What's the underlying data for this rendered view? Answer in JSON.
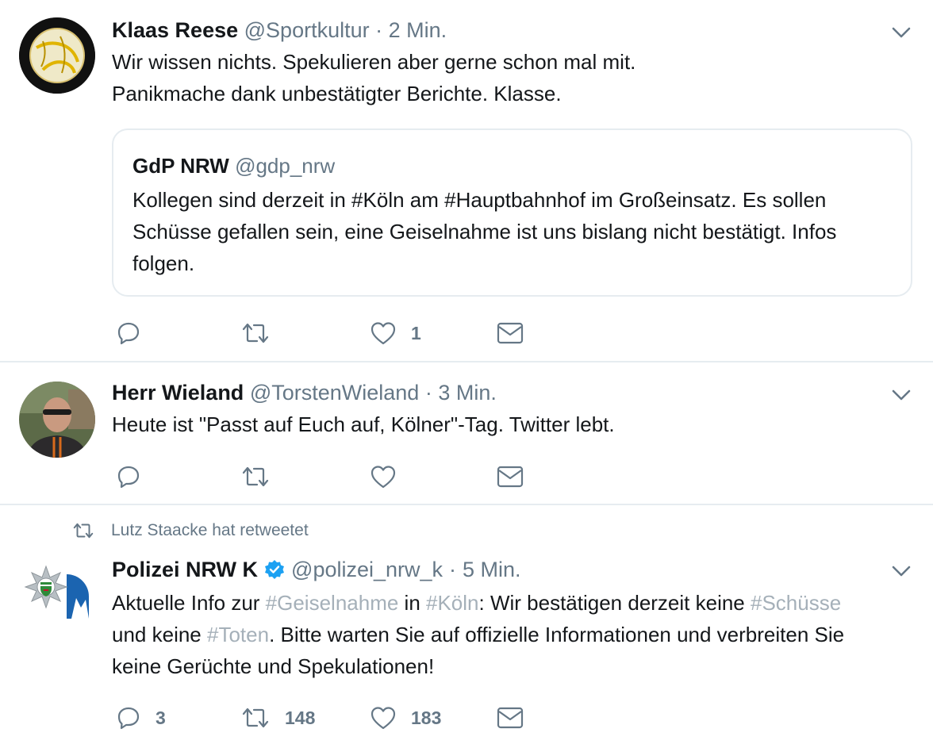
{
  "tweets": [
    {
      "name": "Klaas Reese",
      "handle": "@Sportkultur",
      "separator": "·",
      "time": "2 Min.",
      "text_lines": [
        "Wir wissen nichts. Spekulieren aber gerne schon mal mit.",
        "Panikmache dank unbestätigter Berichte. Klasse."
      ],
      "quote": {
        "name": "GdP NRW",
        "handle": "@gdp_nrw",
        "text_lines": [
          "Kollegen sind derzeit in #Köln am #Hauptbahnhof im Großeinsatz. Es sollen",
          "Schüsse gefallen sein, eine Geiselnahme ist uns bislang nicht bestätigt. Infos",
          "folgen."
        ]
      },
      "counts": {
        "reply": "",
        "retweet": "",
        "like": "1"
      }
    },
    {
      "name": "Herr Wieland",
      "handle": "@TorstenWieland",
      "separator": "·",
      "time": "3 Min.",
      "text_lines": [
        "Heute ist \"Passt auf Euch auf, Kölner\"-Tag. Twitter lebt."
      ],
      "counts": {
        "reply": "",
        "retweet": "",
        "like": ""
      }
    },
    {
      "retweet_context": "Lutz Staacke hat retweetet",
      "name": "Polizei NRW K",
      "handle": "@polizei_nrw_k",
      "separator": "·",
      "time": "5 Min.",
      "verified": true,
      "text": {
        "l1_a": "Aktuelle Info zur ",
        "l1_h1": "#Geiselnahme",
        "l1_b": " in ",
        "l1_h2": "#Köln",
        "l1_c": ": Wir bestätigen derzeit keine ",
        "l1_h3": "#Schüsse",
        "l2_a": "und keine ",
        "l2_h1": "#Toten",
        "l2_b": ". Bitte warten Sie auf offizielle Informationen und verbreiten Sie",
        "l3": "keine Gerüchte und Spekulationen!"
      },
      "counts": {
        "reply": "3",
        "retweet": "148",
        "like": "183"
      }
    }
  ],
  "colors": {
    "text": "#14171a",
    "secondary": "#657786",
    "hashtag": "#a5b0b9",
    "border": "#e6ecf0",
    "verified": "#1da1f2"
  },
  "icons": [
    "reply-icon",
    "retweet-icon",
    "like-icon",
    "dm-icon",
    "caret-down-icon",
    "verified-badge-icon"
  ]
}
